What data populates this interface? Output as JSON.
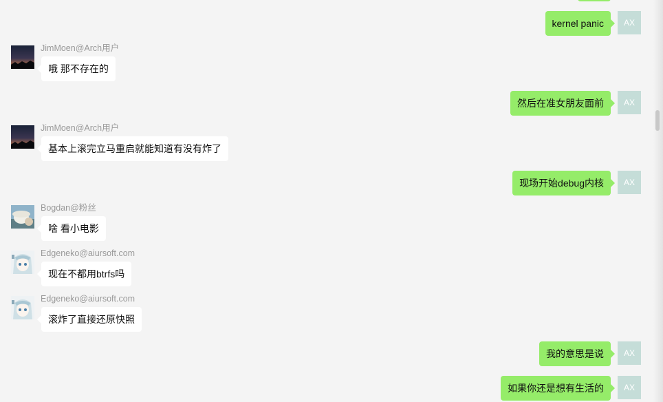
{
  "self_avatar_text": "AX",
  "colors": {
    "background": "#f4f4f4",
    "outgoing_bubble": "#95ec69",
    "incoming_bubble": "#ffffff",
    "self_avatar": "#c5ddd8",
    "sender_name": "#999999"
  },
  "messages": [
    {
      "direction": "out",
      "text": "kernel panic"
    },
    {
      "direction": "in",
      "sender": "JimMoen@Arch用户",
      "avatar_icon": "night-sky-avatar-icon",
      "text": "哦 那不存在的"
    },
    {
      "direction": "out",
      "text": "然后在准女朋友面前"
    },
    {
      "direction": "in",
      "sender": "JimMoen@Arch用户",
      "avatar_icon": "night-sky-avatar-icon",
      "text": "基本上滚完立马重启就能知道有没有炸了"
    },
    {
      "direction": "out",
      "text": "现场开始debug内核"
    },
    {
      "direction": "in",
      "sender": "Bogdan@粉丝",
      "avatar_icon": "hat-person-avatar-icon",
      "text": "啥 看小电影"
    },
    {
      "direction": "in",
      "sender": "Edgeneko@aiursoft.com",
      "avatar_icon": "anime-girl-avatar-icon",
      "text": "现在不都用btrfs吗"
    },
    {
      "direction": "in",
      "sender": "Edgeneko@aiursoft.com",
      "avatar_icon": "anime-girl-avatar-icon",
      "text": "滚炸了直接还原快照"
    },
    {
      "direction": "out",
      "text": "我的意思是说"
    },
    {
      "direction": "out",
      "text": "如果你还是想有生活的"
    }
  ]
}
